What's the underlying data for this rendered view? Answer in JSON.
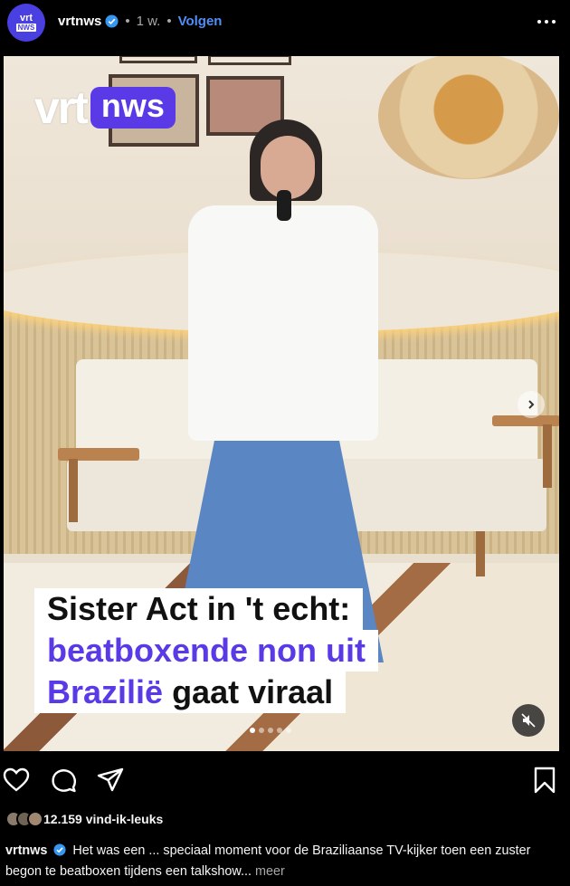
{
  "post": {
    "avatar_text_top": "vrt",
    "avatar_text_bottom": "NWS",
    "username": "vrtnws",
    "separator": "•",
    "time": "1 w.",
    "follow_label": "Volgen"
  },
  "media": {
    "logo_vrt": "vrt",
    "logo_nws": "nws",
    "caption_line1": "Sister Act in 't echt:",
    "caption_line2": "beatboxende non uit",
    "caption_line3_purple": "Brazilië",
    "caption_line3_rest": " gaat viraal",
    "carousel_position": 1,
    "carousel_count": 5
  },
  "actions": {
    "like_icon": "heart-icon",
    "comment_icon": "comment-icon",
    "share_icon": "send-icon",
    "save_icon": "bookmark-icon"
  },
  "likes": {
    "text": "12.159 vind-ik-leuks"
  },
  "description": {
    "username": "vrtnws",
    "text": "Het was een ... speciaal moment voor de Braziliaanse TV-kijker toen een zuster begon te beatboxen tijdens een talkshow...",
    "more": "meer"
  },
  "colors": {
    "background": "#000000",
    "accent": "#5a39e6",
    "link": "#4f8ff7"
  }
}
